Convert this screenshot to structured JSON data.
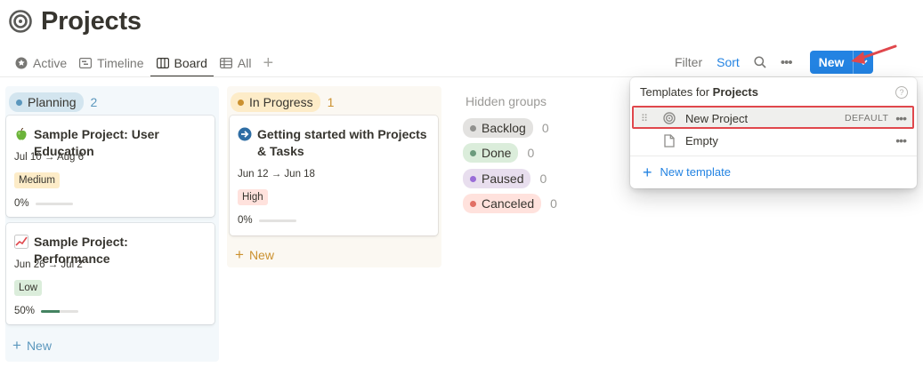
{
  "page": {
    "title": "Projects"
  },
  "tabs": [
    {
      "label": "Active",
      "icon": "star-icon",
      "active": false
    },
    {
      "label": "Timeline",
      "icon": "timeline-icon",
      "active": false
    },
    {
      "label": "Board",
      "icon": "board-icon",
      "active": true
    },
    {
      "label": "All",
      "icon": "table-icon",
      "active": false
    }
  ],
  "toolbar": {
    "filter_label": "Filter",
    "sort_label": "Sort",
    "new_label": "New",
    "accent_color": "#2383e2"
  },
  "columns": {
    "planning": {
      "name": "Planning",
      "count": "2",
      "color": "#5b97bd",
      "bg": "#d3e5ef",
      "cards": [
        {
          "icon": "apple-icon",
          "title": "Sample Project: User Education",
          "dates": "Jul 10 → Aug 6",
          "priority": "Medium",
          "priority_bg": "#fdecc8",
          "progress_label": "0%",
          "progress": 0
        },
        {
          "icon": "chart-increasing-icon",
          "title": "Sample Project: Performance",
          "dates": "Jun 26 → Jul 2",
          "priority": "Low",
          "priority_bg": "#dbeddb",
          "progress_label": "50%",
          "progress": 0.5
        }
      ],
      "new_label": "New"
    },
    "in_progress": {
      "name": "In Progress",
      "count": "1",
      "color": "#cb912f",
      "bg": "#fdecc8",
      "cards": [
        {
          "icon": "arrow-right-circle-icon",
          "title": "Getting started with Projects & Tasks",
          "dates": "Jun 12 → Jun 18",
          "priority": "High",
          "priority_bg": "#ffe2dd",
          "progress_label": "0%",
          "progress": 0
        }
      ],
      "new_label": "New"
    }
  },
  "hidden_groups": {
    "title": "Hidden groups",
    "items": [
      {
        "name": "Backlog",
        "count": "0",
        "bg": "#e3e2e0",
        "dot": "#91918e"
      },
      {
        "name": "Done",
        "count": "0",
        "bg": "#dbeddb",
        "dot": "#6c9b7d"
      },
      {
        "name": "Paused",
        "count": "0",
        "bg": "#e8deee",
        "dot": "#9a6dd7"
      },
      {
        "name": "Canceled",
        "count": "0",
        "bg": "#ffe2dd",
        "dot": "#e16f64"
      }
    ]
  },
  "templates_menu": {
    "title_prefix": "Templates for",
    "title_db": "Projects",
    "items": [
      {
        "label": "New Project",
        "badge": "DEFAULT",
        "icon": "target-icon"
      },
      {
        "label": "Empty",
        "badge": "",
        "icon": "page-icon"
      }
    ],
    "new_template_label": "New template"
  }
}
